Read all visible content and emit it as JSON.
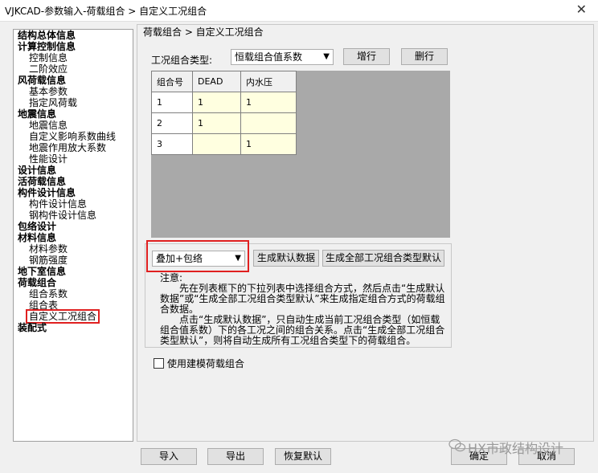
{
  "window": {
    "title": "VJKCAD-参数输入-荷载组合 > 自定义工况组合",
    "close_glyph": "✕"
  },
  "tree": [
    {
      "label": "结构总体信息",
      "level": 0
    },
    {
      "label": "计算控制信息",
      "level": 0
    },
    {
      "label": "控制信息",
      "level": 1
    },
    {
      "label": "二阶效应",
      "level": 1
    },
    {
      "label": "风荷载信息",
      "level": 0
    },
    {
      "label": "基本参数",
      "level": 1
    },
    {
      "label": "指定风荷载",
      "level": 1
    },
    {
      "label": "地震信息",
      "level": 0
    },
    {
      "label": "地震信息",
      "level": 1
    },
    {
      "label": "自定义影响系数曲线",
      "level": 1
    },
    {
      "label": "地震作用放大系数",
      "level": 1
    },
    {
      "label": "性能设计",
      "level": 1
    },
    {
      "label": "设计信息",
      "level": 0
    },
    {
      "label": "活荷载信息",
      "level": 0
    },
    {
      "label": "构件设计信息",
      "level": 0
    },
    {
      "label": "构件设计信息",
      "level": 1
    },
    {
      "label": "钢构件设计信息",
      "level": 1
    },
    {
      "label": "包络设计",
      "level": 0
    },
    {
      "label": "材料信息",
      "level": 0
    },
    {
      "label": "材料参数",
      "level": 1
    },
    {
      "label": "钢筋强度",
      "level": 1
    },
    {
      "label": "地下室信息",
      "level": 0
    },
    {
      "label": "荷载组合",
      "level": 0
    },
    {
      "label": "组合系数",
      "level": 1
    },
    {
      "label": "组合表",
      "level": 1
    },
    {
      "label": "自定义工况组合",
      "level": 1,
      "selected": true
    },
    {
      "label": "装配式",
      "level": 0
    }
  ],
  "main": {
    "breadcrumb": "荷载组合 > 自定义工况组合",
    "type_label": "工况组合类型:",
    "type_value": "恒载组合值系数",
    "add_row": "增行",
    "del_row": "删行",
    "grid": {
      "columns": [
        "组合号",
        "DEAD",
        "内水压"
      ],
      "rows": [
        [
          "1",
          "1",
          "1"
        ],
        [
          "2",
          "1",
          ""
        ],
        [
          "3",
          "",
          "1"
        ]
      ]
    },
    "combine_mode": "叠加+包络",
    "gen_default": "生成默认数据",
    "gen_all_default": "生成全部工况组合类型默认",
    "note_title": "注意:",
    "note_p1": "先在列表框下的下拉列表中选择组合方式，然后点击“生成默认数据”或“生成全部工况组合类型默认”来生成指定组合方式的荷载组合数据。",
    "note_p2": "点击“生成默认数据”，只自动生成当前工况组合类型（如恒载组合值系数）下的各工况之间的组合关系。点击“生成全部工况组合类型默认”，则将自动生成所有工况组合类型下的荷载组合。",
    "use_model_combo": "使用建模荷载组合"
  },
  "footer": {
    "import": "导入",
    "export": "导出",
    "restore": "恢复默认",
    "ok": "确定",
    "cancel": "取消"
  },
  "watermark": "HX市政结构设计"
}
